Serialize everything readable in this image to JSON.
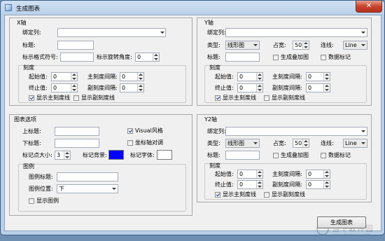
{
  "window": {
    "title": "生成图表",
    "close": "✕"
  },
  "x_axis": {
    "title": "X轴",
    "bind_col_label": "绑定列:",
    "bind_col_value": "",
    "title_label": "标题:",
    "title_value": "",
    "fmt_label": "标示格式符号:",
    "fmt_value": "",
    "rot_label": "标示旋转角度:",
    "rot_value": "0",
    "scale": {
      "title": "刻度",
      "start_label": "起始值:",
      "start_value": "0",
      "main_label": "主刻度间隔:",
      "main_value": "0",
      "end_label": "终止值:",
      "end_value": "0",
      "sub_label": "副刻度间隔:",
      "sub_value": "0",
      "show_main": "显示主刻度线",
      "show_main_checked": true,
      "show_sub": "显示副刻度线",
      "show_sub_checked": false
    }
  },
  "y_axis": {
    "title": "Y轴",
    "bind_col_label": "绑定列:",
    "type_label": "类型:",
    "type_value": "线形图",
    "width_label": "占宽:",
    "width_value": "50",
    "line_label": "连线:",
    "line_value": "Line",
    "title_label": "标题:",
    "stack_label": "生成叠加图",
    "stack_checked": false,
    "marker_label": "数据标记",
    "marker_checked": false,
    "scale": {
      "title": "刻度",
      "start_label": "起始值:",
      "start_value": "0",
      "main_label": "主刻度间隔:",
      "main_value": "0",
      "end_label": "终止值:",
      "end_value": "0",
      "sub_label": "副刻度间隔:",
      "sub_value": "0",
      "show_main": "显示主刻度线",
      "show_main_checked": true,
      "show_sub": "显示副刻度线",
      "show_sub_checked": false
    }
  },
  "chart_options": {
    "title": "图表选项",
    "top_title_label": "上标题:",
    "bottom_title_label": "下标题:",
    "visual_label": "Visual风格",
    "visual_checked": true,
    "coord_label": "坐标轴对调",
    "coord_checked": false,
    "marker_size_label": "标记点大小:",
    "marker_size_value": "3",
    "marker_bg_label": "标记背景:",
    "marker_bg_color": "#0000ff",
    "marker_font_label": "标记字体:",
    "legend": {
      "title": "图例",
      "legend_title_label": "图例标题:",
      "legend_pos_label": "图例位置:",
      "legend_pos_value": "下",
      "show_legend": "显示图例",
      "show_legend_checked": false
    }
  },
  "y2_axis": {
    "title": "Y2轴",
    "bind_col_label": "绑定列:",
    "type_label": "类型:",
    "type_value": "线形图",
    "width_label": "占宽:",
    "width_value": "50",
    "line_label": "连线:",
    "line_value": "Line",
    "title_label": "标题:",
    "stack_label": "生成叠加图",
    "stack_checked": false,
    "marker_label": "数据标记",
    "marker_checked": false,
    "scale": {
      "title": "刻度",
      "start_label": "起始值:",
      "start_value": "0",
      "main_label": "主刻度间隔:",
      "main_value": "0",
      "end_label": "终止值:",
      "end_value": "0",
      "sub_label": "副刻度间隔:",
      "sub_value": "0",
      "show_main": "显示主刻度线",
      "show_main_checked": true,
      "show_sub": "显示副刻度线",
      "show_sub_checked": false
    }
  },
  "generate_button": "生成图表",
  "watermark": {
    "text": "当下软件园",
    "url": "www.downxia.com"
  }
}
